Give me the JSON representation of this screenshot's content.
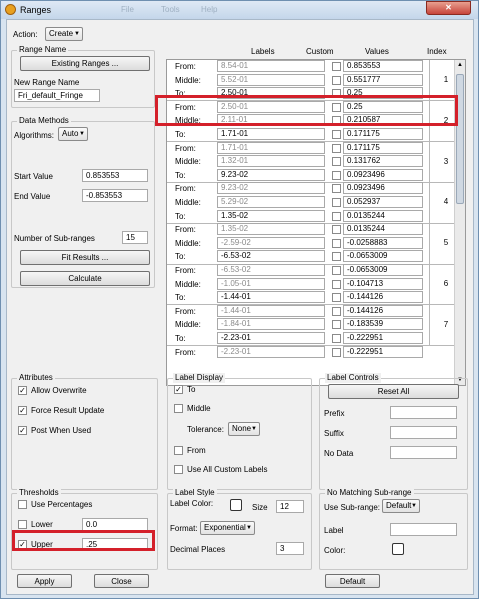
{
  "app": {
    "title": "Ranges",
    "close_glyph": "✕"
  },
  "bg_menu": [
    "File",
    "Tools",
    "Help"
  ],
  "top": {
    "action_label": "Action:",
    "action_value": "Create"
  },
  "range_name": {
    "title": "Range Name",
    "existing_btn": "Existing Ranges ...",
    "new_label": "New Range Name",
    "new_value": "Fri_default_Fringe"
  },
  "data_methods": {
    "title": "Data Methods",
    "algorithms_label": "Algorithms:",
    "algorithms_value": "Auto",
    "start_label": "Start Value",
    "start_value": "0.853553",
    "end_label": "End Value",
    "end_value": "-0.853553",
    "subranges_label": "Number of Sub-ranges",
    "subranges_value": "15",
    "fit_btn": "Fit Results ...",
    "calc_btn": "Calculate"
  },
  "table": {
    "headers": {
      "labels": "Labels",
      "custom": "Custom",
      "values": "Values",
      "index": "Index"
    },
    "row_labels": {
      "from": "From:",
      "middle": "Middle:",
      "to": "To:"
    },
    "ranges": [
      {
        "index": "1",
        "from_label": "8.54-01",
        "from_val": "0.853553",
        "middle_label": "5.52-01",
        "middle_val": "0.551777",
        "to_label": "2.50-01",
        "to_val": "0.25"
      },
      {
        "index": "2",
        "from_label": "2.50-01",
        "from_val": "0.25",
        "middle_label": "2.11-01",
        "middle_val": "0.210587",
        "to_label": "1.71-01",
        "to_val": "0.171175"
      },
      {
        "index": "3",
        "from_label": "1.71-01",
        "from_val": "0.171175",
        "middle_label": "1.32-01",
        "middle_val": "0.131762",
        "to_label": "9.23-02",
        "to_val": "0.0923496"
      },
      {
        "index": "4",
        "from_label": "9.23-02",
        "from_val": "0.0923496",
        "middle_label": "5.29-02",
        "middle_val": "0.052937",
        "to_label": "1.35-02",
        "to_val": "0.0135244"
      },
      {
        "index": "5",
        "from_label": "1.35-02",
        "from_val": "0.0135244",
        "middle_label": "-2.59-02",
        "middle_val": "-0.0258883",
        "to_label": "-6.53-02",
        "to_val": "-0.0653009"
      },
      {
        "index": "6",
        "from_label": "-6.53-02",
        "from_val": "-0.0653009",
        "middle_label": "-1.05-01",
        "middle_val": "-0.104713",
        "to_label": "-1.44-01",
        "to_val": "-0.144126"
      },
      {
        "index": "7",
        "from_label": "-1.44-01",
        "from_val": "-0.144126",
        "middle_label": "-1.84-01",
        "middle_val": "-0.183539",
        "to_label": "-2.23-01",
        "to_val": "-0.222951"
      }
    ],
    "partial": {
      "from_label": "-2.23-01",
      "from_val": "-0.222951"
    }
  },
  "attributes": {
    "title": "Attributes",
    "allow_overwrite": "Allow Overwrite",
    "force_update": "Force Result Update",
    "post_when_used": "Post When Used"
  },
  "label_display": {
    "title": "Label Display",
    "to": "To",
    "middle": "Middle",
    "tolerance_label": "Tolerance:",
    "tolerance_value": "None",
    "from": "From",
    "use_all": "Use All Custom Labels"
  },
  "label_controls": {
    "title": "Label Controls",
    "reset_btn": "Reset All",
    "prefix": "Prefix",
    "suffix": "Suffix",
    "no_data": "No Data"
  },
  "thresholds": {
    "title": "Thresholds",
    "use_pct": "Use Percentages",
    "lower_label": "Lower",
    "lower_value": "0.0",
    "upper_label": "Upper",
    "upper_value": ".25"
  },
  "label_style": {
    "title": "Label Style",
    "color_label": "Label Color:",
    "size_label": "Size",
    "size_value": "12",
    "format_label": "Format:",
    "format_value": "Exponential",
    "decimals_label": "Decimal Places",
    "decimals_value": "3"
  },
  "no_match": {
    "title": "No Matching Sub-range",
    "use_label": "Use Sub-range:",
    "use_value": "Default",
    "label": "Label",
    "color": "Color:"
  },
  "bottom": {
    "apply": "Apply",
    "close": "Close",
    "default": "Default"
  },
  "glyphs": {
    "check": "✓",
    "arrow": "▼"
  }
}
